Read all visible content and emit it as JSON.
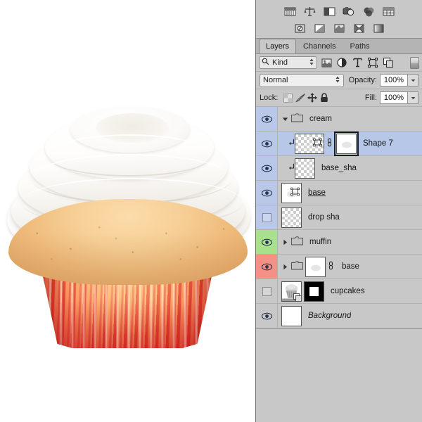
{
  "app": {
    "name": "Adobe Photoshop Layers Panel"
  },
  "canvas": {
    "artwork_name": "cupcake-illustration",
    "background_color": "#ffffff",
    "frosting_color": "#ffffff",
    "cake_color": "#eeb978",
    "liner_red": "#e2302a",
    "liner_cream": "#ffe8c4"
  },
  "adjustments": {
    "row1": [
      {
        "name": "brightness-contrast-icon",
        "label": "Brightness/Contrast"
      },
      {
        "name": "levels-icon",
        "label": "Levels"
      },
      {
        "name": "curves-icon",
        "label": "Curves"
      },
      {
        "name": "exposure-icon",
        "label": "Exposure"
      },
      {
        "name": "vibrance-icon",
        "label": "Vibrance"
      },
      {
        "name": "hue-saturation-icon",
        "label": "Hue/Saturation"
      }
    ],
    "row2": [
      {
        "name": "color-balance-icon",
        "label": "Color Balance"
      },
      {
        "name": "black-white-icon",
        "label": "Black & White"
      },
      {
        "name": "photo-filter-icon",
        "label": "Photo Filter"
      },
      {
        "name": "channel-mixer-icon",
        "label": "Channel Mixer"
      },
      {
        "name": "gradient-map-icon",
        "label": "Gradient Map"
      }
    ]
  },
  "tabs": [
    {
      "label": "Layers",
      "active": true
    },
    {
      "label": "Channels",
      "active": false
    },
    {
      "label": "Paths",
      "active": false
    }
  ],
  "filter": {
    "kind_label": "Kind",
    "search_icon": "magnifier-icon",
    "icons": [
      {
        "name": "filter-pixel-layers-icon",
        "label": "Pixel layers"
      },
      {
        "name": "filter-adjustment-layers-icon",
        "label": "Adjustment layers"
      },
      {
        "name": "filter-type-layers-icon",
        "label": "Type layers"
      },
      {
        "name": "filter-shape-layers-icon",
        "label": "Shape layers"
      },
      {
        "name": "filter-smart-objects-icon",
        "label": "Smart objects"
      }
    ],
    "toggle_name": "filter-enable-toggle"
  },
  "blend": {
    "mode": "Normal",
    "opacity_label": "Opacity:",
    "opacity_value": "100%"
  },
  "lock": {
    "label": "Lock:",
    "items": [
      {
        "name": "lock-transparent-pixels-icon",
        "label": "Lock transparent pixels"
      },
      {
        "name": "lock-image-pixels-icon",
        "label": "Lock image pixels"
      },
      {
        "name": "lock-position-icon",
        "label": "Lock position"
      },
      {
        "name": "lock-all-icon",
        "label": "Lock all"
      }
    ],
    "fill_label": "Fill:",
    "fill_value": "100%"
  },
  "layers": [
    {
      "name": "cream",
      "visible": true,
      "eye_tint": "tint-blue",
      "selected": false,
      "type": "group",
      "expanded": true,
      "disclosure": "down",
      "clipped": false,
      "linked": false,
      "thumb": "none",
      "mask": "none",
      "style": "normal"
    },
    {
      "name": "Shape 7",
      "visible": true,
      "eye_tint": "tint-blue",
      "selected": true,
      "type": "shape",
      "expanded": false,
      "disclosure": "none",
      "clipped": true,
      "linked": true,
      "thumb": "checker-wide-vector",
      "mask": "white-selected",
      "style": "normal"
    },
    {
      "name": "base_sha",
      "visible": true,
      "eye_tint": "tint-blue",
      "selected": false,
      "type": "pixel",
      "expanded": false,
      "disclosure": "none",
      "clipped": true,
      "linked": false,
      "thumb": "checker",
      "mask": "none",
      "style": "normal"
    },
    {
      "name": "base",
      "visible": true,
      "eye_tint": "tint-blue",
      "selected": false,
      "type": "shape",
      "expanded": false,
      "disclosure": "none",
      "clipped": false,
      "linked": false,
      "thumb": "white-vector",
      "mask": "none",
      "style": "underline"
    },
    {
      "name": "drop sha",
      "visible": false,
      "eye_tint": "tint-blue",
      "selected": false,
      "type": "pixel",
      "expanded": false,
      "disclosure": "none",
      "clipped": false,
      "linked": false,
      "thumb": "checker",
      "mask": "none",
      "style": "normal"
    },
    {
      "name": "muffin",
      "visible": true,
      "eye_tint": "tint-green",
      "selected": false,
      "type": "group",
      "expanded": false,
      "disclosure": "right",
      "clipped": false,
      "linked": false,
      "thumb": "none",
      "mask": "none",
      "style": "normal"
    },
    {
      "name": "base",
      "visible": true,
      "eye_tint": "tint-red",
      "selected": false,
      "type": "group",
      "expanded": false,
      "disclosure": "right",
      "clipped": false,
      "linked": true,
      "thumb": "white-blob",
      "mask": "none",
      "style": "normal"
    },
    {
      "name": "cupcakes",
      "visible": false,
      "eye_tint": "tint-none",
      "selected": false,
      "type": "smart-object",
      "expanded": false,
      "disclosure": "none",
      "clipped": false,
      "linked": false,
      "thumb": "cupcake-smart",
      "mask": "black-with-white-square",
      "style": "normal"
    },
    {
      "name": "Background",
      "visible": true,
      "eye_tint": "tint-none",
      "selected": false,
      "type": "background",
      "expanded": false,
      "disclosure": "none",
      "clipped": false,
      "linked": false,
      "thumb": "white",
      "mask": "none",
      "style": "italic"
    }
  ]
}
